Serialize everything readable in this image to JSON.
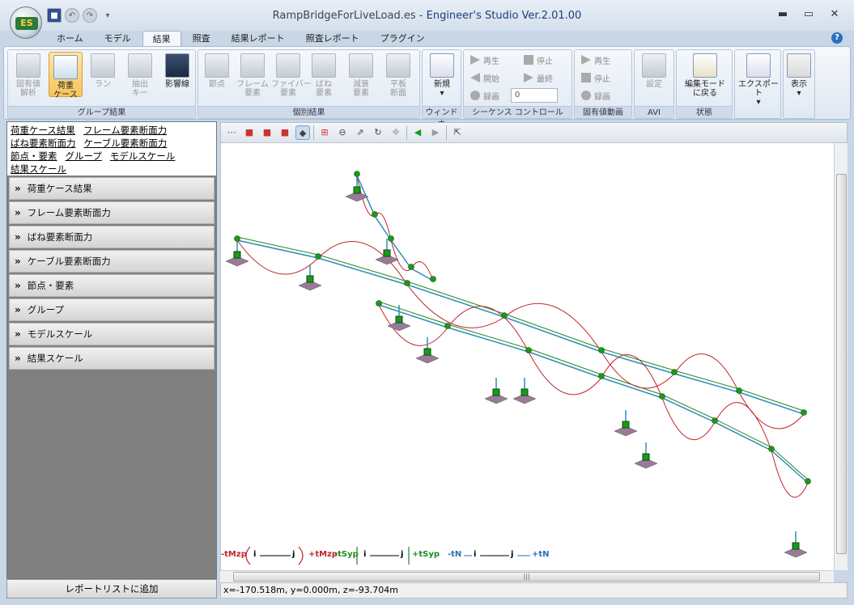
{
  "window": {
    "file": "RampBridgeForLiveLoad.es",
    "separator": " - ",
    "app": "Engineer's Studio Ver.2.01.00",
    "app_logo": "ES",
    "minimize": "▬",
    "restore": "▭",
    "close": "✕"
  },
  "tabs": [
    "ホーム",
    "モデル",
    "結果",
    "照査",
    "結果レポート",
    "照査レポート",
    "プラグイン"
  ],
  "active_tab": 2,
  "ribbon": {
    "group_result": {
      "label": "グループ結果",
      "buttons": [
        "固有値\n解析",
        "荷重\nケース",
        "ラン",
        "抽出\nキー",
        "影響線"
      ]
    },
    "individual": {
      "label": "個別結果",
      "buttons": [
        "節点",
        "フレーム\n要素",
        "ファイバー\n要素",
        "ばね\n要素",
        "減衰\n要素",
        "平板\n断面"
      ]
    },
    "window": {
      "label": "ウィンドウ",
      "button": "新規"
    },
    "sequence": {
      "label": "シーケンス コントロール",
      "play": "再生",
      "stop": "停止",
      "start": "開始",
      "last": "最終",
      "record": "録画",
      "frame": "0"
    },
    "eigen": {
      "label": "固有値動画",
      "play": "再生",
      "stop": "停止",
      "record": "録画"
    },
    "avi": {
      "label": "AVI",
      "button": "設定"
    },
    "state": {
      "label": "状態",
      "button": "編集モード\nに戻る"
    },
    "export": {
      "button": "エクスポート"
    },
    "display": {
      "button": "表示"
    }
  },
  "links": [
    "荷重ケース結果",
    "フレーム要素断面力",
    "ばね要素断面力",
    "ケーブル要素断面力",
    "節点・要素",
    "グループ",
    "モデルスケール",
    "結果スケール"
  ],
  "accordion": [
    "荷重ケース結果",
    "フレーム要素断面力",
    "ばね要素断面力",
    "ケーブル要素断面力",
    "節点・要素",
    "グループ",
    "モデルスケール",
    "結果スケール"
  ],
  "accordion_chevron": "»",
  "add_report_button": "レポートリストに追加",
  "legend": {
    "mzp_neg": "-tMzp",
    "mzp_pos": "+tMzp",
    "syp_neg": "-tSyp",
    "syp_pos": "+tSyp",
    "n_neg": "-tN",
    "n_pos": "+tN",
    "i": "i",
    "j": "j"
  },
  "status": "x=-170.518m, y=0.000m, z=-93.704m",
  "colors": {
    "moment": "#c0262b",
    "shear": "#1f8a1f",
    "axial": "#2a6fb8",
    "frame": "#2c8fb8",
    "node": "#1a9a1a"
  }
}
